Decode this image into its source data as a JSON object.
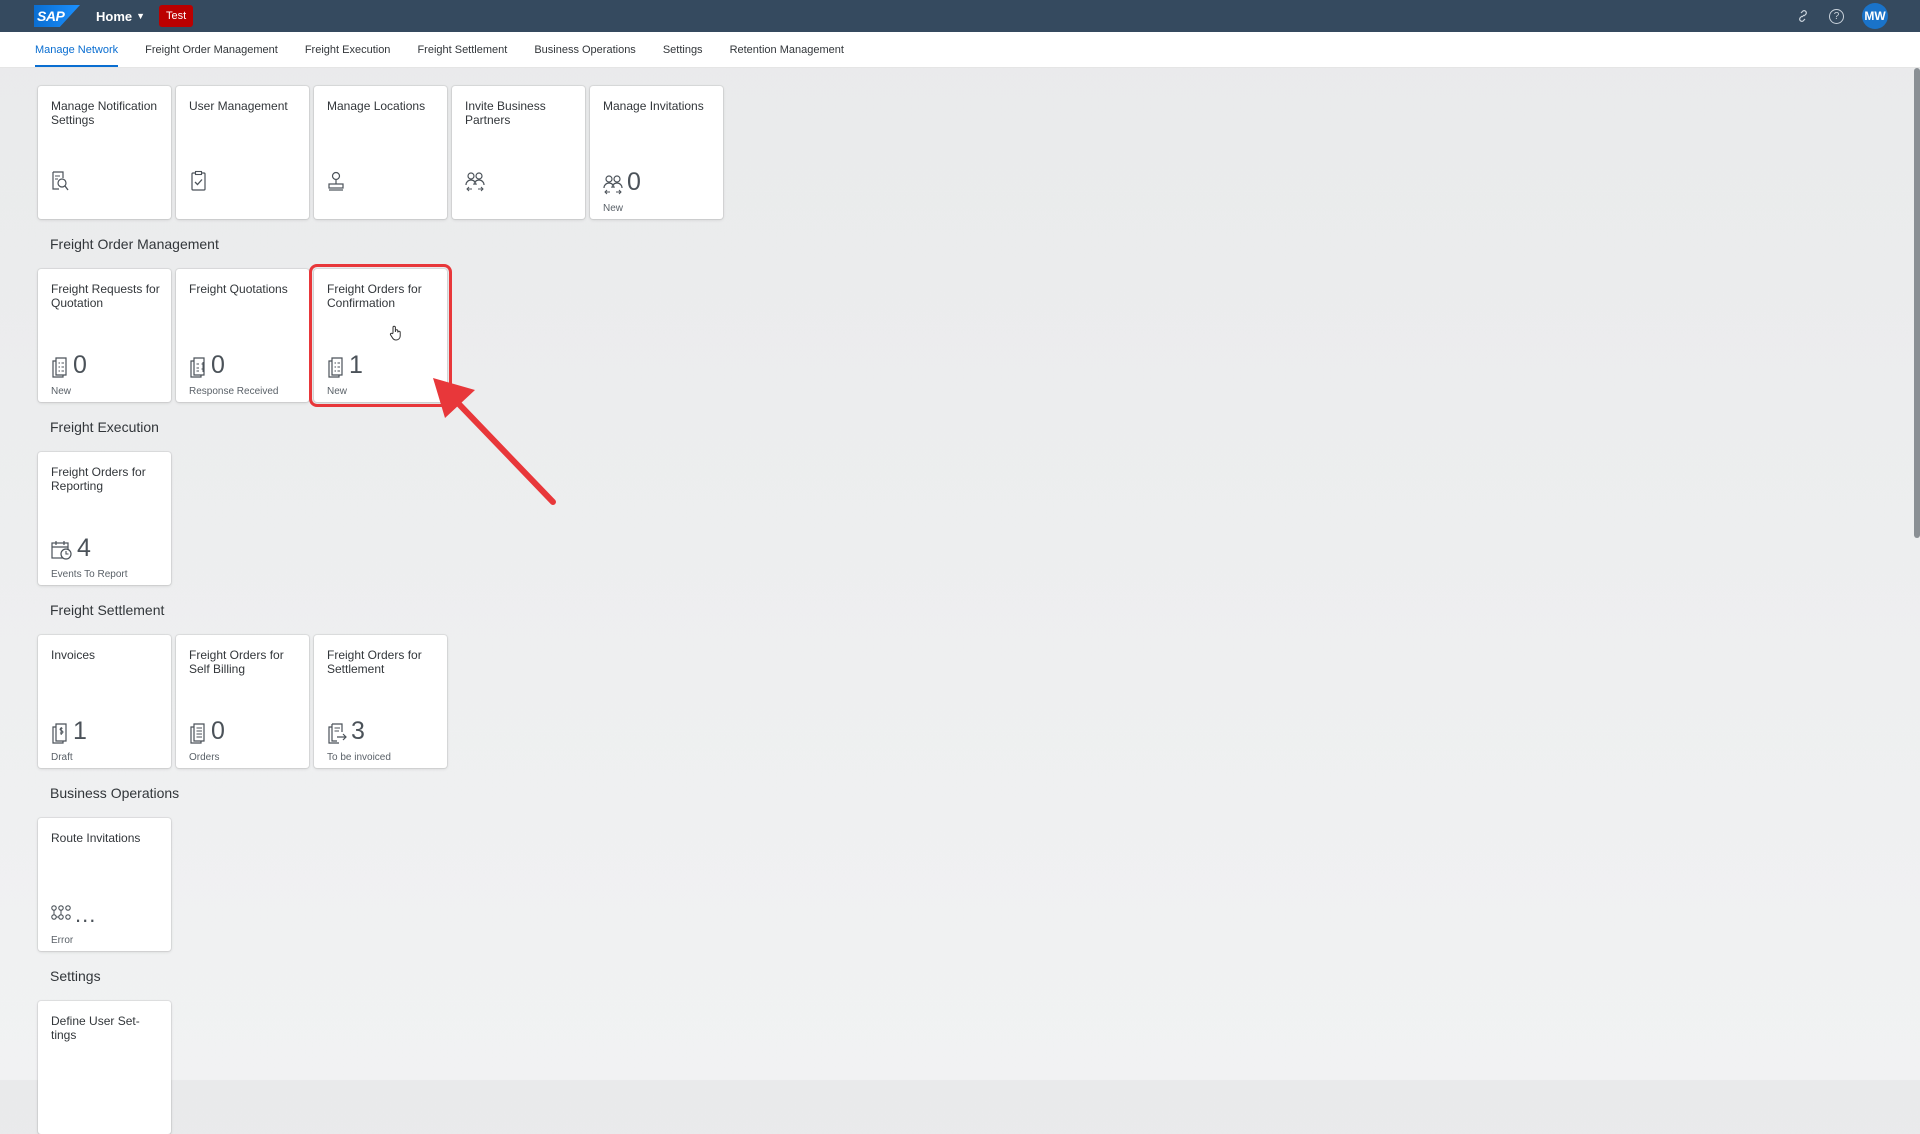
{
  "shell": {
    "logo_text": "SAP",
    "home_label": "Home",
    "env_badge": "Test",
    "user_initials": "MW",
    "icons": [
      "link-icon",
      "help-icon"
    ]
  },
  "tabs": [
    {
      "label": "Manage Network",
      "active": true
    },
    {
      "label": "Freight Order Management",
      "active": false
    },
    {
      "label": "Freight Execution",
      "active": false
    },
    {
      "label": "Freight Settlement",
      "active": false
    },
    {
      "label": "Business Operations",
      "active": false
    },
    {
      "label": "Settings",
      "active": false
    },
    {
      "label": "Retention Management",
      "active": false
    }
  ],
  "groups": {
    "network": {
      "tiles": [
        {
          "title": "Manage Notification Settings",
          "icon": "notification-search-icon"
        },
        {
          "title": "User Management",
          "icon": "clipboard-check-icon"
        },
        {
          "title": "Manage Locations",
          "icon": "location-pin-icon"
        },
        {
          "title": "Invite Business Partners",
          "icon": "partners-icon"
        },
        {
          "title": "Manage Invitations",
          "icon": "partners-icon",
          "kpi": "0",
          "footer": "New"
        }
      ]
    },
    "freight_order_management": {
      "title": "Freight Order Management",
      "tiles": [
        {
          "title": "Freight Requests for Quotation",
          "icon": "document-list-icon",
          "kpi": "0",
          "footer": "New"
        },
        {
          "title": "Freight Quotations",
          "icon": "document-price-icon",
          "kpi": "0",
          "footer": "Response Received"
        },
        {
          "title": "Freight Orders for Confirmation",
          "icon": "document-list-icon",
          "kpi": "1",
          "footer": "New",
          "highlighted": true
        }
      ]
    },
    "freight_execution": {
      "title": "Freight Execution",
      "tiles": [
        {
          "title": "Freight Orders for Reporting",
          "icon": "calendar-clock-icon",
          "kpi": "4",
          "footer": "Events To Report"
        }
      ]
    },
    "freight_settlement": {
      "title": "Freight Settlement",
      "tiles": [
        {
          "title": "Invoices",
          "icon": "invoice-icon",
          "kpi": "1",
          "footer": "Draft"
        },
        {
          "title": "Freight Orders for Self Billing",
          "icon": "document-lines-icon",
          "kpi": "0",
          "footer": "Orders"
        },
        {
          "title": "Freight Orders for Settlement",
          "icon": "document-arrow-icon",
          "kpi": "3",
          "footer": "To be invoiced"
        }
      ]
    },
    "business_operations": {
      "title": "Business Operations",
      "tiles": [
        {
          "title": "Route Invitations",
          "icon": "network-nodes-icon",
          "kpi": "...",
          "footer": "Error"
        }
      ]
    },
    "settings": {
      "title": "Settings",
      "tiles": [
        {
          "title": "Define User Set- tings",
          "icon": ""
        }
      ]
    }
  },
  "colors": {
    "shell_bg": "#354a5f",
    "accent": "#0a6ed1",
    "badge": "#bb0000",
    "highlight": "#e8373a"
  }
}
